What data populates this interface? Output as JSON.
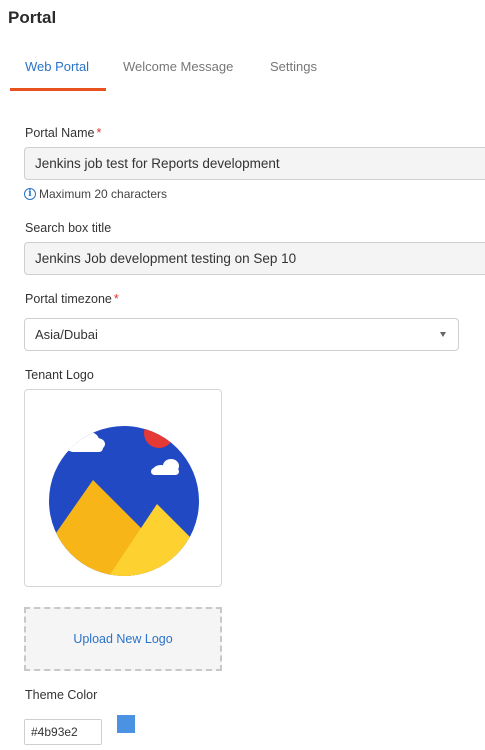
{
  "page": {
    "title": "Portal"
  },
  "tabs": [
    {
      "label": "Web Portal",
      "active": true
    },
    {
      "label": "Welcome Message",
      "active": false
    },
    {
      "label": "Settings",
      "active": false
    }
  ],
  "form": {
    "portal_name": {
      "label": "Portal Name",
      "required_marker": "*",
      "value": "Jenkins job test for Reports development",
      "hint": "Maximum 20 characters"
    },
    "search_box_title": {
      "label": "Search box title",
      "value": "Jenkins Job development testing on Sep 10"
    },
    "portal_timezone": {
      "label": "Portal timezone",
      "required_marker": "*",
      "selected": "Asia/Dubai"
    },
    "tenant_logo": {
      "label": "Tenant Logo",
      "upload_label": "Upload New Logo"
    },
    "theme_color": {
      "label": "Theme Color",
      "value": "#4b93e2",
      "swatch_color": "#4b93e2"
    }
  },
  "icons": {
    "hint": "info-icon",
    "select": "chevron-down-icon",
    "logo": "landscape-image-icon"
  },
  "colors": {
    "accent": "#2a73c8",
    "tab_underline": "#e8501e",
    "required": "#e0342a",
    "logo_sky": "#2049c3",
    "logo_sun": "#e53935",
    "logo_mountain_back": "#f7b518",
    "logo_mountain_front": "#fdd230"
  }
}
